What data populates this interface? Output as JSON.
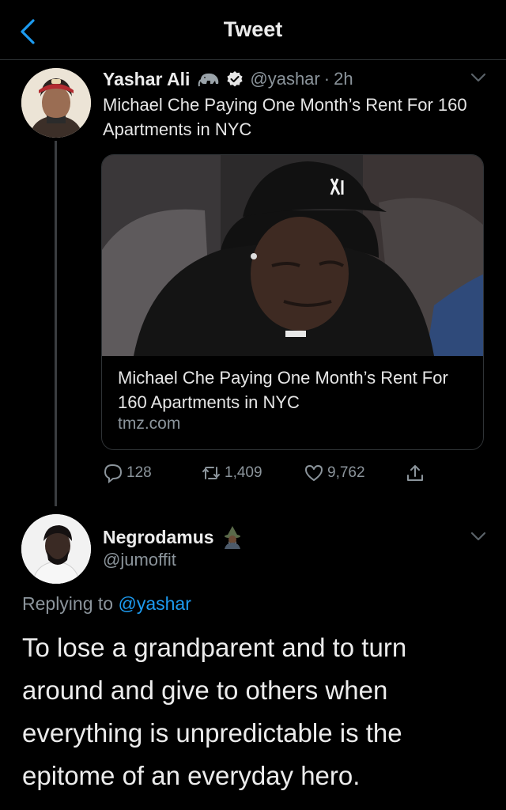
{
  "header": {
    "title": "Tweet",
    "back_icon": "chevron-left-icon",
    "accent": "#1d9bf0"
  },
  "tweet": {
    "author_name": "Yashar Ali",
    "author_emoji": "elephant-emoji",
    "verified_icon": "verified-badge-icon",
    "handle": "@yashar",
    "separator": "·",
    "time": "2h",
    "text": "Michael Che Paying One Month’s Rent For 160 Apartments in NYC",
    "card": {
      "title": "Michael Che Paying One Month’s Rent For 160 Apartments in NYC",
      "domain": "tmz.com"
    },
    "actions": {
      "replies": "128",
      "retweets": "1,409",
      "likes": "9,762"
    }
  },
  "reply": {
    "author_name": "Negrodamus",
    "author_emoji": "mage-emoji",
    "handle": "@jumoffit",
    "replying_prefix": "Replying to",
    "replying_to": "@yashar",
    "text": "To lose a grandparent and to turn around and give to others when everything is unpredictable is the epitome of an everyday hero."
  },
  "colors": {
    "background": "#000000",
    "secondary_text": "#8b949b",
    "link": "#1d9bf0",
    "divider": "#2f3336"
  }
}
